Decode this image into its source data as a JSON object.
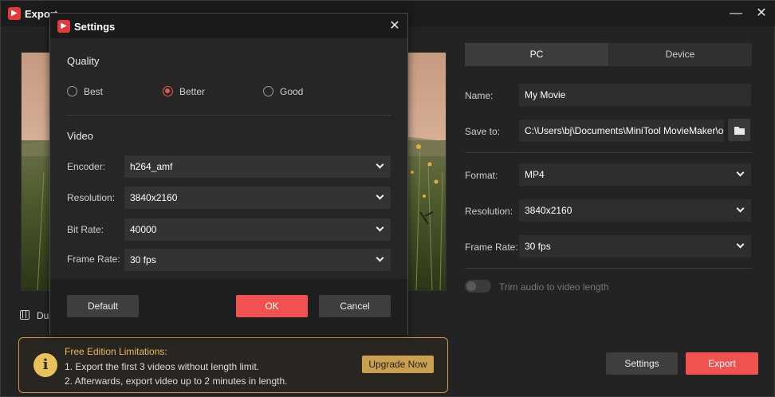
{
  "export_window": {
    "title": "Export",
    "duration_label": "Dur",
    "tabs": [
      {
        "label": "PC",
        "active": true
      },
      {
        "label": "Device",
        "active": false
      }
    ],
    "name": {
      "label": "Name:",
      "value": "My Movie"
    },
    "save_to": {
      "label": "Save to:",
      "value": "C:\\Users\\bj\\Documents\\MiniTool MovieMaker\\outp"
    },
    "format": {
      "label": "Format:",
      "value": "MP4"
    },
    "resolution": {
      "label": "Resolution:",
      "value": "3840x2160"
    },
    "frame_rate": {
      "label": "Frame Rate:",
      "value": "30 fps"
    },
    "trim_toggle": {
      "label": "Trim audio to video length",
      "enabled": false
    },
    "notice": {
      "title": "Free Edition Limitations:",
      "line1": "1. Export the first 3 videos without length limit.",
      "line2": "2. Afterwards, export video up to 2 minutes in length.",
      "upgrade_label": "Upgrade Now"
    },
    "settings_button": "Settings",
    "export_button": "Export"
  },
  "settings_dialog": {
    "title": "Settings",
    "quality": {
      "heading": "Quality",
      "options": [
        {
          "label": "Best",
          "selected": false
        },
        {
          "label": "Better",
          "selected": true
        },
        {
          "label": "Good",
          "selected": false
        }
      ]
    },
    "video": {
      "heading": "Video",
      "encoder": {
        "label": "Encoder:",
        "value": "h264_amf"
      },
      "resolution": {
        "label": "Resolution:",
        "value": "3840x2160"
      },
      "bit_rate": {
        "label": "Bit Rate:",
        "value": "40000"
      },
      "frame_rate": {
        "label": "Frame Rate:",
        "value": "30 fps"
      }
    },
    "buttons": {
      "default": "Default",
      "ok": "OK",
      "cancel": "Cancel"
    }
  },
  "colors": {
    "accent_red": "#f0524f",
    "notice_gold": "#c89a4b",
    "background": "#232323"
  }
}
